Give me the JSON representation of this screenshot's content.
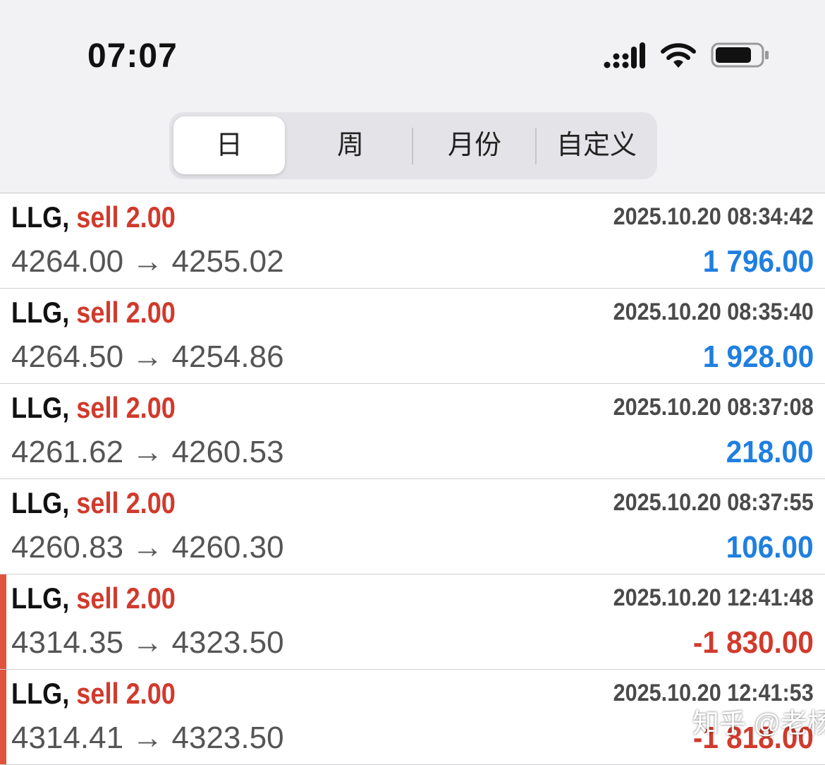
{
  "status_bar": {
    "time": "07:07",
    "signal_icon": "cellular-signal-icon",
    "wifi_icon": "wifi-icon",
    "battery_icon": "battery-icon"
  },
  "period_tabs": [
    {
      "label": "日",
      "active": true
    },
    {
      "label": "周",
      "active": false
    },
    {
      "label": "月份",
      "active": false
    },
    {
      "label": "自定义",
      "active": false
    }
  ],
  "colors": {
    "profit": "#1f7fe0",
    "loss": "#d13a2c",
    "side": "#d13a2c"
  },
  "trades": [
    {
      "symbol": "LLG,",
      "side": "sell 2.00",
      "datetime": "2025.10.20 08:34:42",
      "prices": "4264.00 → 4255.02",
      "profit": "1 796.00",
      "is_loss": false
    },
    {
      "symbol": "LLG,",
      "side": "sell 2.00",
      "datetime": "2025.10.20 08:35:40",
      "prices": "4264.50 → 4254.86",
      "profit": "1 928.00",
      "is_loss": false
    },
    {
      "symbol": "LLG,",
      "side": "sell 2.00",
      "datetime": "2025.10.20 08:37:08",
      "prices": "4261.62 → 4260.53",
      "profit": "218.00",
      "is_loss": false
    },
    {
      "symbol": "LLG,",
      "side": "sell 2.00",
      "datetime": "2025.10.20 08:37:55",
      "prices": "4260.83 → 4260.30",
      "profit": "106.00",
      "is_loss": false
    },
    {
      "symbol": "LLG,",
      "side": "sell 2.00",
      "datetime": "2025.10.20 12:41:48",
      "prices": "4314.35 → 4323.50",
      "profit": "-1 830.00",
      "is_loss": true
    },
    {
      "symbol": "LLG,",
      "side": "sell 2.00",
      "datetime": "2025.10.20 12:41:53",
      "prices": "4314.41 → 4323.50",
      "profit": "-1 818.00",
      "is_loss": true
    }
  ],
  "watermark": "知乎 @老杨丶"
}
